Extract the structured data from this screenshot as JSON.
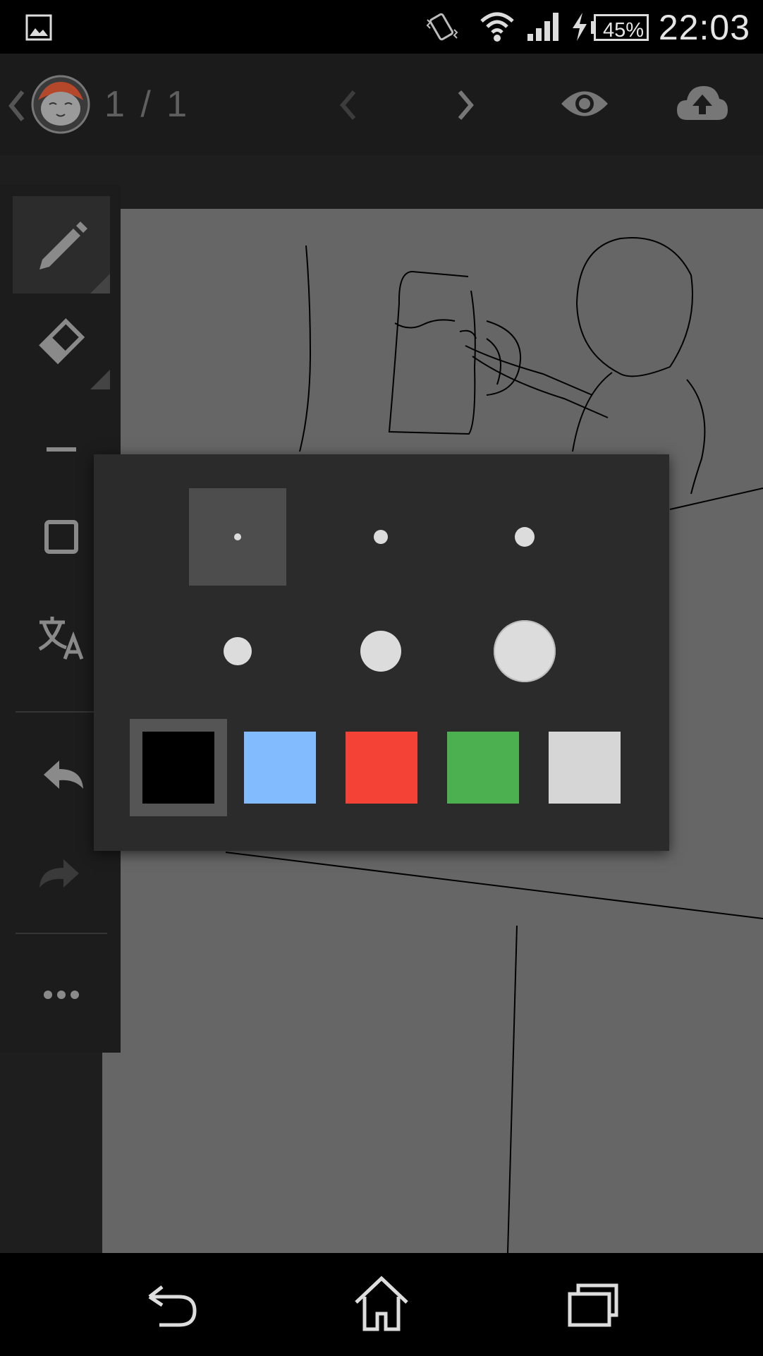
{
  "status_bar": {
    "icons": [
      "image-icon",
      "vibrate-icon",
      "wifi-icon",
      "signal-icon",
      "charging-icon",
      "battery-icon"
    ],
    "battery": "45%",
    "time": "22:03"
  },
  "top_bar": {
    "page_counter": "1 / 1",
    "icons": [
      "back-chevron-icon",
      "avatar",
      "prev-page-icon",
      "next-page-icon",
      "eye-icon",
      "cloud-upload-icon"
    ]
  },
  "toolbar": {
    "tools": [
      "pen-icon",
      "eraser-icon",
      "line-icon",
      "rectangle-icon",
      "text-translate-icon",
      "undo-icon",
      "redo-icon",
      "more-icon"
    ],
    "active_tool": "pen-icon"
  },
  "brush_popup": {
    "sizes": [
      1,
      2,
      3,
      4,
      5,
      6
    ],
    "selected_size": 1,
    "colors": [
      "#000000",
      "#82bcff",
      "#f44336",
      "#4caf50",
      "#d6d6d6"
    ],
    "selected_color": "#000000"
  },
  "nav_bar": {
    "icons": [
      "back-icon",
      "home-icon",
      "recents-icon"
    ]
  },
  "theme": {
    "background": "#000000",
    "topbar": "#1b1b1b",
    "canvas": "#666666",
    "popup": "#2b2b2b"
  }
}
